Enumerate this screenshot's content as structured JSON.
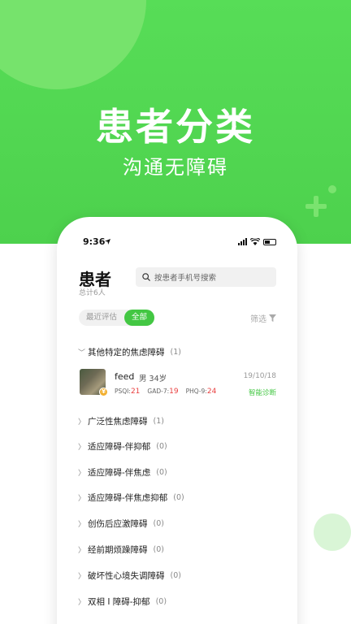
{
  "hero": {
    "title": "患者分类",
    "subtitle": "沟通无障碍"
  },
  "status_bar": {
    "time": "9:36",
    "location_icon": "location-arrow-icon"
  },
  "header": {
    "title": "患者",
    "total": "总计6人"
  },
  "search": {
    "placeholder": "按患者手机号搜索"
  },
  "segment": {
    "recent": "最近评估",
    "all": "全部",
    "active": "all"
  },
  "filter_label": "筛选",
  "groups": [
    {
      "name": "其他特定的焦虑障碍",
      "count": "(1)",
      "expanded": true
    },
    {
      "name": "广泛性焦虑障碍",
      "count": "(1)",
      "expanded": false
    },
    {
      "name": "适应障碍-伴抑郁",
      "count": "(0)",
      "expanded": false
    },
    {
      "name": "适应障碍-伴焦虑",
      "count": "(0)",
      "expanded": false
    },
    {
      "name": "适应障碍-伴焦虑抑郁",
      "count": "(0)",
      "expanded": false
    },
    {
      "name": "创伤后应激障碍",
      "count": "(0)",
      "expanded": false
    },
    {
      "name": "经前期烦躁障碍",
      "count": "(0)",
      "expanded": false
    },
    {
      "name": "破坏性心境失调障碍",
      "count": "(0)",
      "expanded": false
    },
    {
      "name": "双相 I 障碍-抑郁",
      "count": "(0)",
      "expanded": false
    }
  ],
  "patient": {
    "name": "feed",
    "gender_age": "男 34岁",
    "date": "19/10/18",
    "psqi_label": "PSQI:",
    "psqi": "21",
    "gad_label": "GAD-7:",
    "gad": "19",
    "phq_label": "PHQ-9:",
    "phq": "24",
    "diagnosis_link": "智能诊断",
    "badge": "¥"
  },
  "colors": {
    "brand_green": "#43c743",
    "score_red": "#e94040"
  }
}
